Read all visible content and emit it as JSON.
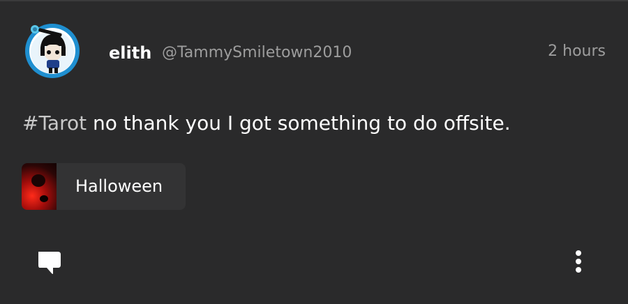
{
  "post": {
    "author": {
      "display_name": "elith",
      "handle": "@TammySmiletown2010",
      "avatar_icon": "cartoon-avatar"
    },
    "timestamp": "2 hours",
    "hashtag": "#Tarot",
    "body": " no thank you I got something to do offsite.",
    "community": {
      "label": "Halloween",
      "thumbnail_icon": "halloween-thumbnail"
    }
  },
  "actions": {
    "comment_icon": "comment-bubble-icon",
    "more_icon": "more-vertical-icon"
  },
  "colors": {
    "background": "#2a2a2b",
    "chip_background": "#333334",
    "muted_text": "#9d9d9d",
    "avatar_ring": "#1f8fd0"
  }
}
